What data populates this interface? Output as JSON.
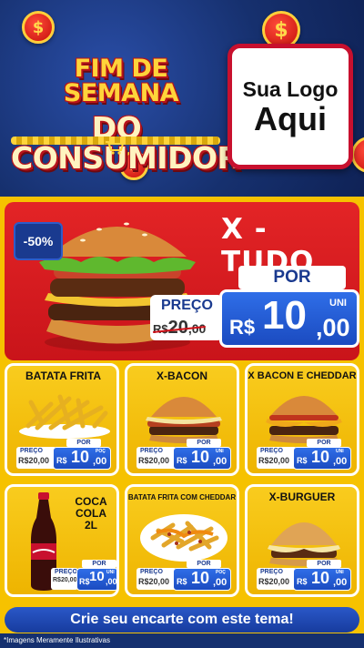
{
  "header": {
    "title_line1": "FIM DE SEMANA",
    "title_line2": "DO CONSUMIDOR",
    "logo_line1": "Sua Logo",
    "logo_line2": "Aqui",
    "coin_symbol": "$"
  },
  "hero": {
    "name": "X - TUDO",
    "discount": "-50%",
    "por_label": "POR",
    "preco_label": "PREÇO",
    "old_currency": "R$",
    "old_int": "20",
    "old_dec": ",00",
    "currency": "R$",
    "new_int": "10",
    "new_dec": ",00",
    "unit": "UNI"
  },
  "products": [
    {
      "name": "BATATA FRITA",
      "preco_label": "PREÇO",
      "old": "R$20,00",
      "por_label": "POR",
      "currency": "R$",
      "new_int": "10",
      "new_dec": ",00",
      "unit": "POÇ"
    },
    {
      "name": "X-BACON",
      "preco_label": "PREÇO",
      "old": "R$20,00",
      "por_label": "POR",
      "currency": "R$",
      "new_int": "10",
      "new_dec": ",00",
      "unit": "UNI"
    },
    {
      "name": "X BACON E CHEDDAR",
      "preco_label": "PREÇO",
      "old": "R$20,00",
      "por_label": "POR",
      "currency": "R$",
      "new_int": "10",
      "new_dec": ",00",
      "unit": "UNI"
    },
    {
      "name": "COCA COLA 2L",
      "preco_label": "PREÇO",
      "old": "R$20,00",
      "por_label": "POR",
      "currency": "R$",
      "new_int": "10",
      "new_dec": ",00",
      "unit": "UNI"
    },
    {
      "name": "BATATA FRITA COM CHEDDAR",
      "preco_label": "PREÇO",
      "old": "R$20,00",
      "por_label": "POR",
      "currency": "R$",
      "new_int": "10",
      "new_dec": ",00",
      "unit": "POÇ"
    },
    {
      "name": "X-BURGUER",
      "preco_label": "PREÇO",
      "old": "R$20,00",
      "por_label": "POR",
      "currency": "R$",
      "new_int": "10",
      "new_dec": ",00",
      "unit": "UNI"
    }
  ],
  "cta": "Crie seu encarte com este tema!",
  "footer_note": "*Imagens Meramente Ilustrativas",
  "colors": {
    "brand_red": "#e32426",
    "brand_blue": "#1b4bc0",
    "brand_yellow": "#f6c200",
    "header_navy": "#16306e"
  }
}
